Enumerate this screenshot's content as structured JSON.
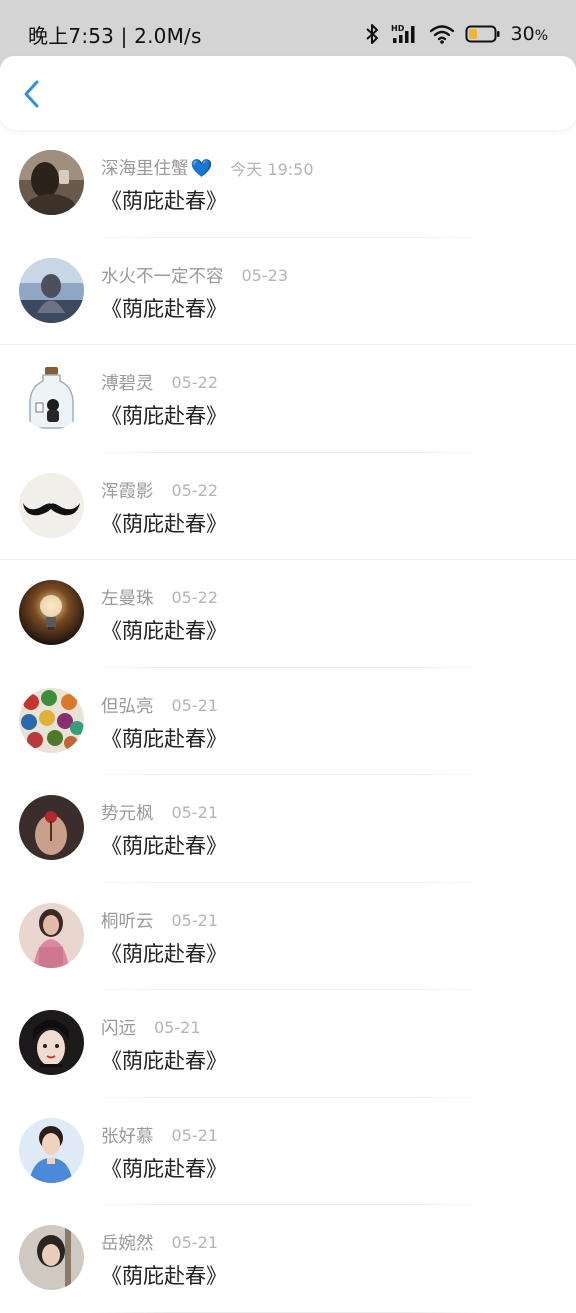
{
  "status_bar": {
    "time_speed": "晚上7:53 | 2.0M/s",
    "battery_pct": "30",
    "battery_unit": "%",
    "network_badge": "HD"
  },
  "nav": {
    "back_icon": "chevron-left-icon",
    "accent": "#2f8fe0"
  },
  "comments": [
    {
      "name": "深海里住蟹",
      "suffix": "💙",
      "time": "今天 19:50",
      "text": "《荫庇赴春》"
    },
    {
      "name": "水火不一定不容",
      "suffix": "",
      "time": "05-23",
      "text": "《荫庇赴春》"
    },
    {
      "name": "溥碧灵",
      "suffix": "",
      "time": "05-22",
      "text": "《荫庇赴春》"
    },
    {
      "name": "浑霞影",
      "suffix": "",
      "time": "05-22",
      "text": "《荫庇赴春》"
    },
    {
      "name": "左曼珠",
      "suffix": "",
      "time": "05-22",
      "text": "《荫庇赴春》"
    },
    {
      "name": "但弘亮",
      "suffix": "",
      "time": "05-21",
      "text": "《荫庇赴春》"
    },
    {
      "name": "势元枫",
      "suffix": "",
      "time": "05-21",
      "text": "《荫庇赴春》"
    },
    {
      "name": "桐听云",
      "suffix": "",
      "time": "05-21",
      "text": "《荫庇赴春》"
    },
    {
      "name": "闪远",
      "suffix": "",
      "time": "05-21",
      "text": "《荫庇赴春》"
    },
    {
      "name": "张好慕",
      "suffix": "",
      "time": "05-21",
      "text": "《荫庇赴春》"
    },
    {
      "name": "岳婉然",
      "suffix": "",
      "time": "05-21",
      "text": "《荫庇赴春》"
    }
  ]
}
